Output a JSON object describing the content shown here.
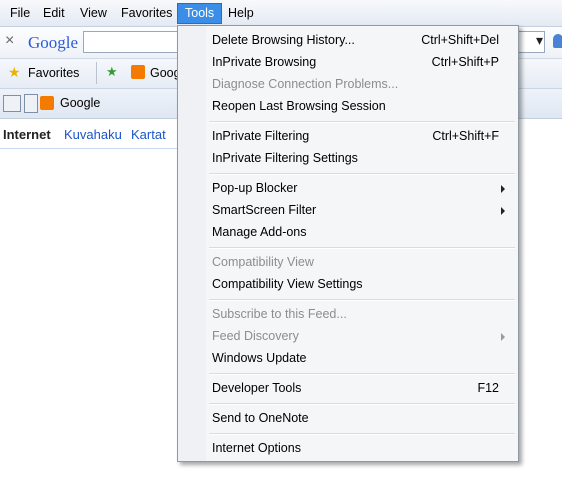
{
  "menubar": {
    "items": [
      {
        "label": "File",
        "active": false
      },
      {
        "label": "Edit",
        "active": false
      },
      {
        "label": "View",
        "active": false
      },
      {
        "label": "Favorites",
        "active": false
      },
      {
        "label": "Tools",
        "active": true
      },
      {
        "label": "Help",
        "active": false
      }
    ]
  },
  "searchbar": {
    "brand": "Google",
    "close_glyph": "×",
    "dropdown_glyph": "▾",
    "input_value": ""
  },
  "favbar": {
    "favorites_label": "Favorites",
    "site_label": "Goog"
  },
  "tabbar": {
    "tab_label": "Google"
  },
  "content": {
    "nav": [
      "Internet",
      "Kuvahaku",
      "Kartat"
    ]
  },
  "tools_menu": {
    "items": [
      {
        "label": "Delete Browsing History...",
        "shortcut": "Ctrl+Shift+Del",
        "disabled": false,
        "submenu": false
      },
      {
        "label": "InPrivate Browsing",
        "shortcut": "Ctrl+Shift+P",
        "disabled": false,
        "submenu": false
      },
      {
        "label": "Diagnose Connection Problems...",
        "shortcut": "",
        "disabled": true,
        "submenu": false
      },
      {
        "label": "Reopen Last Browsing Session",
        "shortcut": "",
        "disabled": false,
        "submenu": false
      },
      {
        "label": "InPrivate Filtering",
        "shortcut": "Ctrl+Shift+F",
        "disabled": false,
        "submenu": false
      },
      {
        "label": "InPrivate Filtering Settings",
        "shortcut": "",
        "disabled": false,
        "submenu": false
      },
      {
        "label": "Pop-up Blocker",
        "shortcut": "",
        "disabled": false,
        "submenu": true
      },
      {
        "label": "SmartScreen Filter",
        "shortcut": "",
        "disabled": false,
        "submenu": true
      },
      {
        "label": "Manage Add-ons",
        "shortcut": "",
        "disabled": false,
        "submenu": false
      },
      {
        "label": "Compatibility View",
        "shortcut": "",
        "disabled": true,
        "submenu": false
      },
      {
        "label": "Compatibility View Settings",
        "shortcut": "",
        "disabled": false,
        "submenu": false
      },
      {
        "label": "Subscribe to this Feed...",
        "shortcut": "",
        "disabled": true,
        "submenu": false
      },
      {
        "label": "Feed Discovery",
        "shortcut": "",
        "disabled": true,
        "submenu": true
      },
      {
        "label": "Windows Update",
        "shortcut": "",
        "disabled": false,
        "submenu": false
      },
      {
        "label": "Developer Tools",
        "shortcut": "F12",
        "disabled": false,
        "submenu": false
      },
      {
        "label": "Send to OneNote",
        "shortcut": "",
        "disabled": false,
        "submenu": false
      },
      {
        "label": "Internet Options",
        "shortcut": "",
        "disabled": false,
        "submenu": false
      }
    ]
  },
  "colors": {
    "menu_highlight": "#3a8ee8",
    "link": "#1a56c9",
    "disabled_text": "#8d8d8d"
  }
}
